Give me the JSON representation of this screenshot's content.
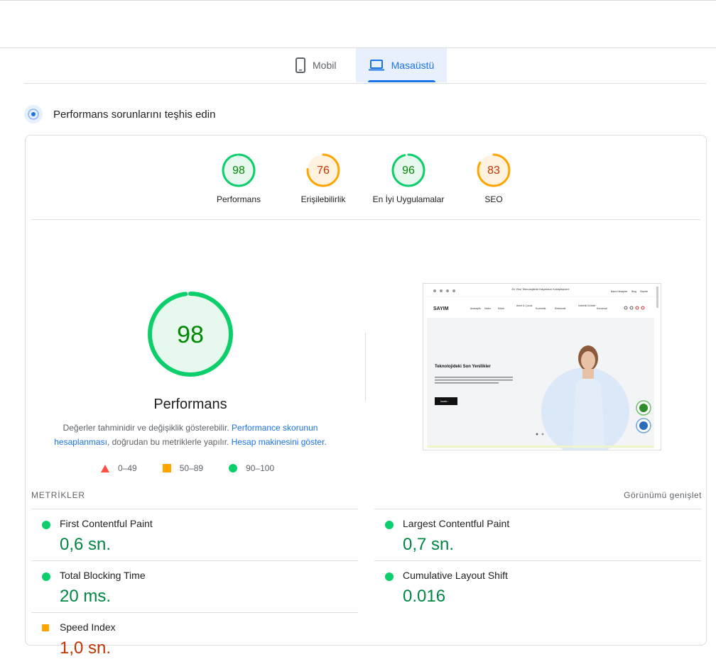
{
  "tabs": {
    "mobile": "Mobil",
    "desktop": "Masaüstü"
  },
  "section": {
    "title": "Performans sorunlarını teşhis edin"
  },
  "gauges": [
    {
      "score": "98",
      "label": "Performans",
      "value": 98,
      "status": "pass"
    },
    {
      "score": "76",
      "label": "Erişilebilirlik",
      "value": 76,
      "status": "average"
    },
    {
      "score": "96",
      "label": "En İyi Uygulamalar",
      "value": 96,
      "status": "pass"
    },
    {
      "score": "83",
      "label": "SEO",
      "value": 83,
      "status": "average"
    }
  ],
  "main_score": {
    "score": "98",
    "value": 98,
    "title": "Performans"
  },
  "description": {
    "text1": "Değerler tahminidir ve değişiklik gösterebilir.",
    "link1": "Performance skorunun hesaplanması",
    "text2": ", doğrudan bu metriklerle yapılır.",
    "link2": "Hesap makinesini göster",
    "text3": "."
  },
  "legend": {
    "fail": "0–49",
    "average": "50–89",
    "pass": "90–100"
  },
  "screenshot": {
    "announcement": "En Yeni Teknolojilerle Hayatınızı Kolaylaştırın!",
    "top_links": [
      "Bana Hesaplar",
      "Blog",
      "Sepete"
    ],
    "logo": "SAYIM",
    "nav": [
      "Anasayfa",
      "Kadın",
      "Erkek",
      "Anne & Çocuk",
      "Kozmetik",
      "Elektronik",
      "İndirimli Ürünler",
      "Kurumsal"
    ],
    "hero_title": "Teknolojideki Son Yenilikler",
    "hero_text": "Geleceğin teknolojisini bugünden deneyimleyin. En yeni ürünlerimizle teknoloji dünyasında bir adım önde olun. Ürünlerimizi keşfedin ve hayatınızı kolaylaştırın.",
    "hero_button": "İncele ›"
  },
  "metrics": {
    "heading": "METRİKLER",
    "expand": "Görünümü genişlet",
    "items": [
      {
        "name": "First Contentful Paint",
        "value": "0,6 sn."
      },
      {
        "name": "Largest Contentful Paint",
        "value": "0,7 sn."
      },
      {
        "name": "Total Blocking Time",
        "value": "20 ms."
      },
      {
        "name": "Cumulative Layout Shift",
        "value": "0.016"
      },
      {
        "name": "Speed Index",
        "value": "1,0 sn."
      }
    ]
  },
  "colors": {
    "pass": "#0cce6b",
    "pass_text": "#008800",
    "pass_bg": "#e7f9ee",
    "average": "#ffa400",
    "average_text": "#c33300",
    "average_bg": "#fff3e0",
    "fail": "#ff4e42",
    "accent": "#1a73e8"
  }
}
